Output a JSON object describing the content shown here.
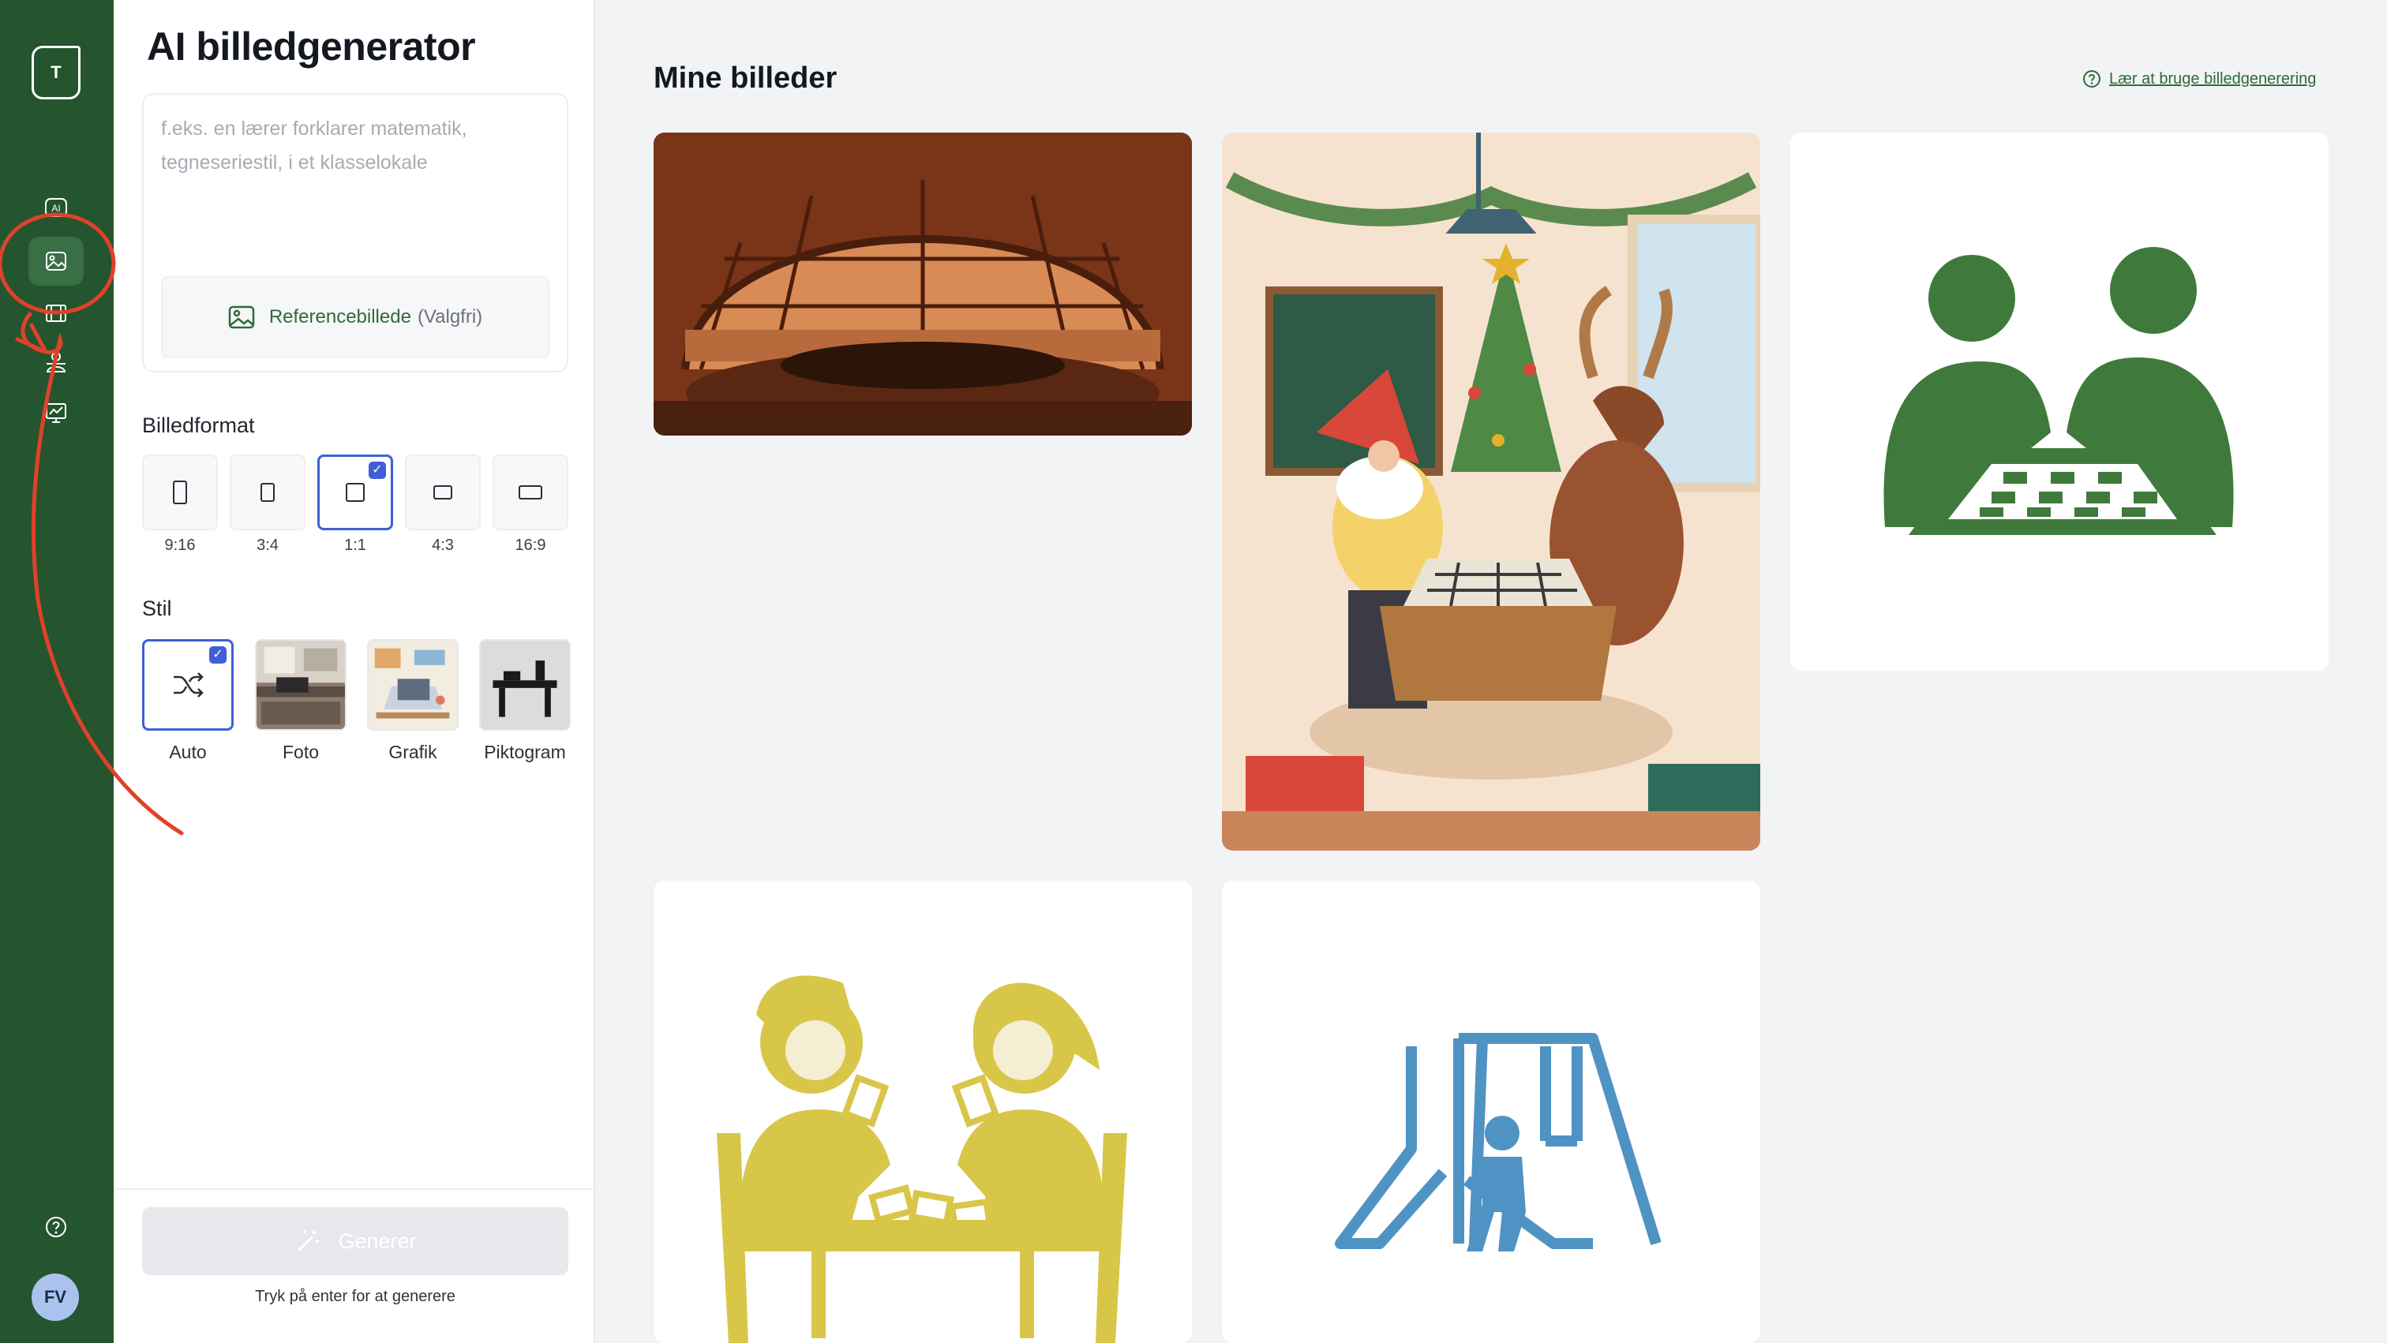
{
  "rail": {
    "logo_letter": "T",
    "ai_label": "AI",
    "avatar_initials": "FV"
  },
  "panel": {
    "title": "AI billedgenerator",
    "prompt_placeholder": "f.eks. en lærer forklarer matematik, tegneseriestil, i et klasselokale",
    "reference_label": "Referencebillede",
    "reference_optional": "(Valgfri)",
    "format_heading": "Billedformat",
    "formats": [
      {
        "label": "9:16",
        "selected": false
      },
      {
        "label": "3:4",
        "selected": false
      },
      {
        "label": "1:1",
        "selected": true
      },
      {
        "label": "4:3",
        "selected": false
      },
      {
        "label": "16:9",
        "selected": false
      }
    ],
    "style_heading": "Stil",
    "styles": [
      {
        "label": "Auto",
        "selected": true
      },
      {
        "label": "Foto",
        "selected": false
      },
      {
        "label": "Grafik",
        "selected": false
      },
      {
        "label": "Piktogram",
        "selected": false
      }
    ],
    "generate_label": "Generer",
    "generate_hint": "Tryk på enter for at generere"
  },
  "main": {
    "title": "Mine billeder",
    "help_link": "Lær at bruge billedgenerering",
    "images": [
      {
        "name": "mars-dome-classroom-photo"
      },
      {
        "name": "christmas-gnome-reindeer-chess-illustration"
      },
      {
        "name": "green-chess-players-pictogram"
      },
      {
        "name": "yellow-card-game-pictogram"
      },
      {
        "name": "blue-playground-pictogram"
      }
    ]
  },
  "colors": {
    "rail": "#24552e",
    "accent_green": "#2e6b3a",
    "select_blue": "#3f5fd8",
    "annotation_red": "#e0412b"
  }
}
